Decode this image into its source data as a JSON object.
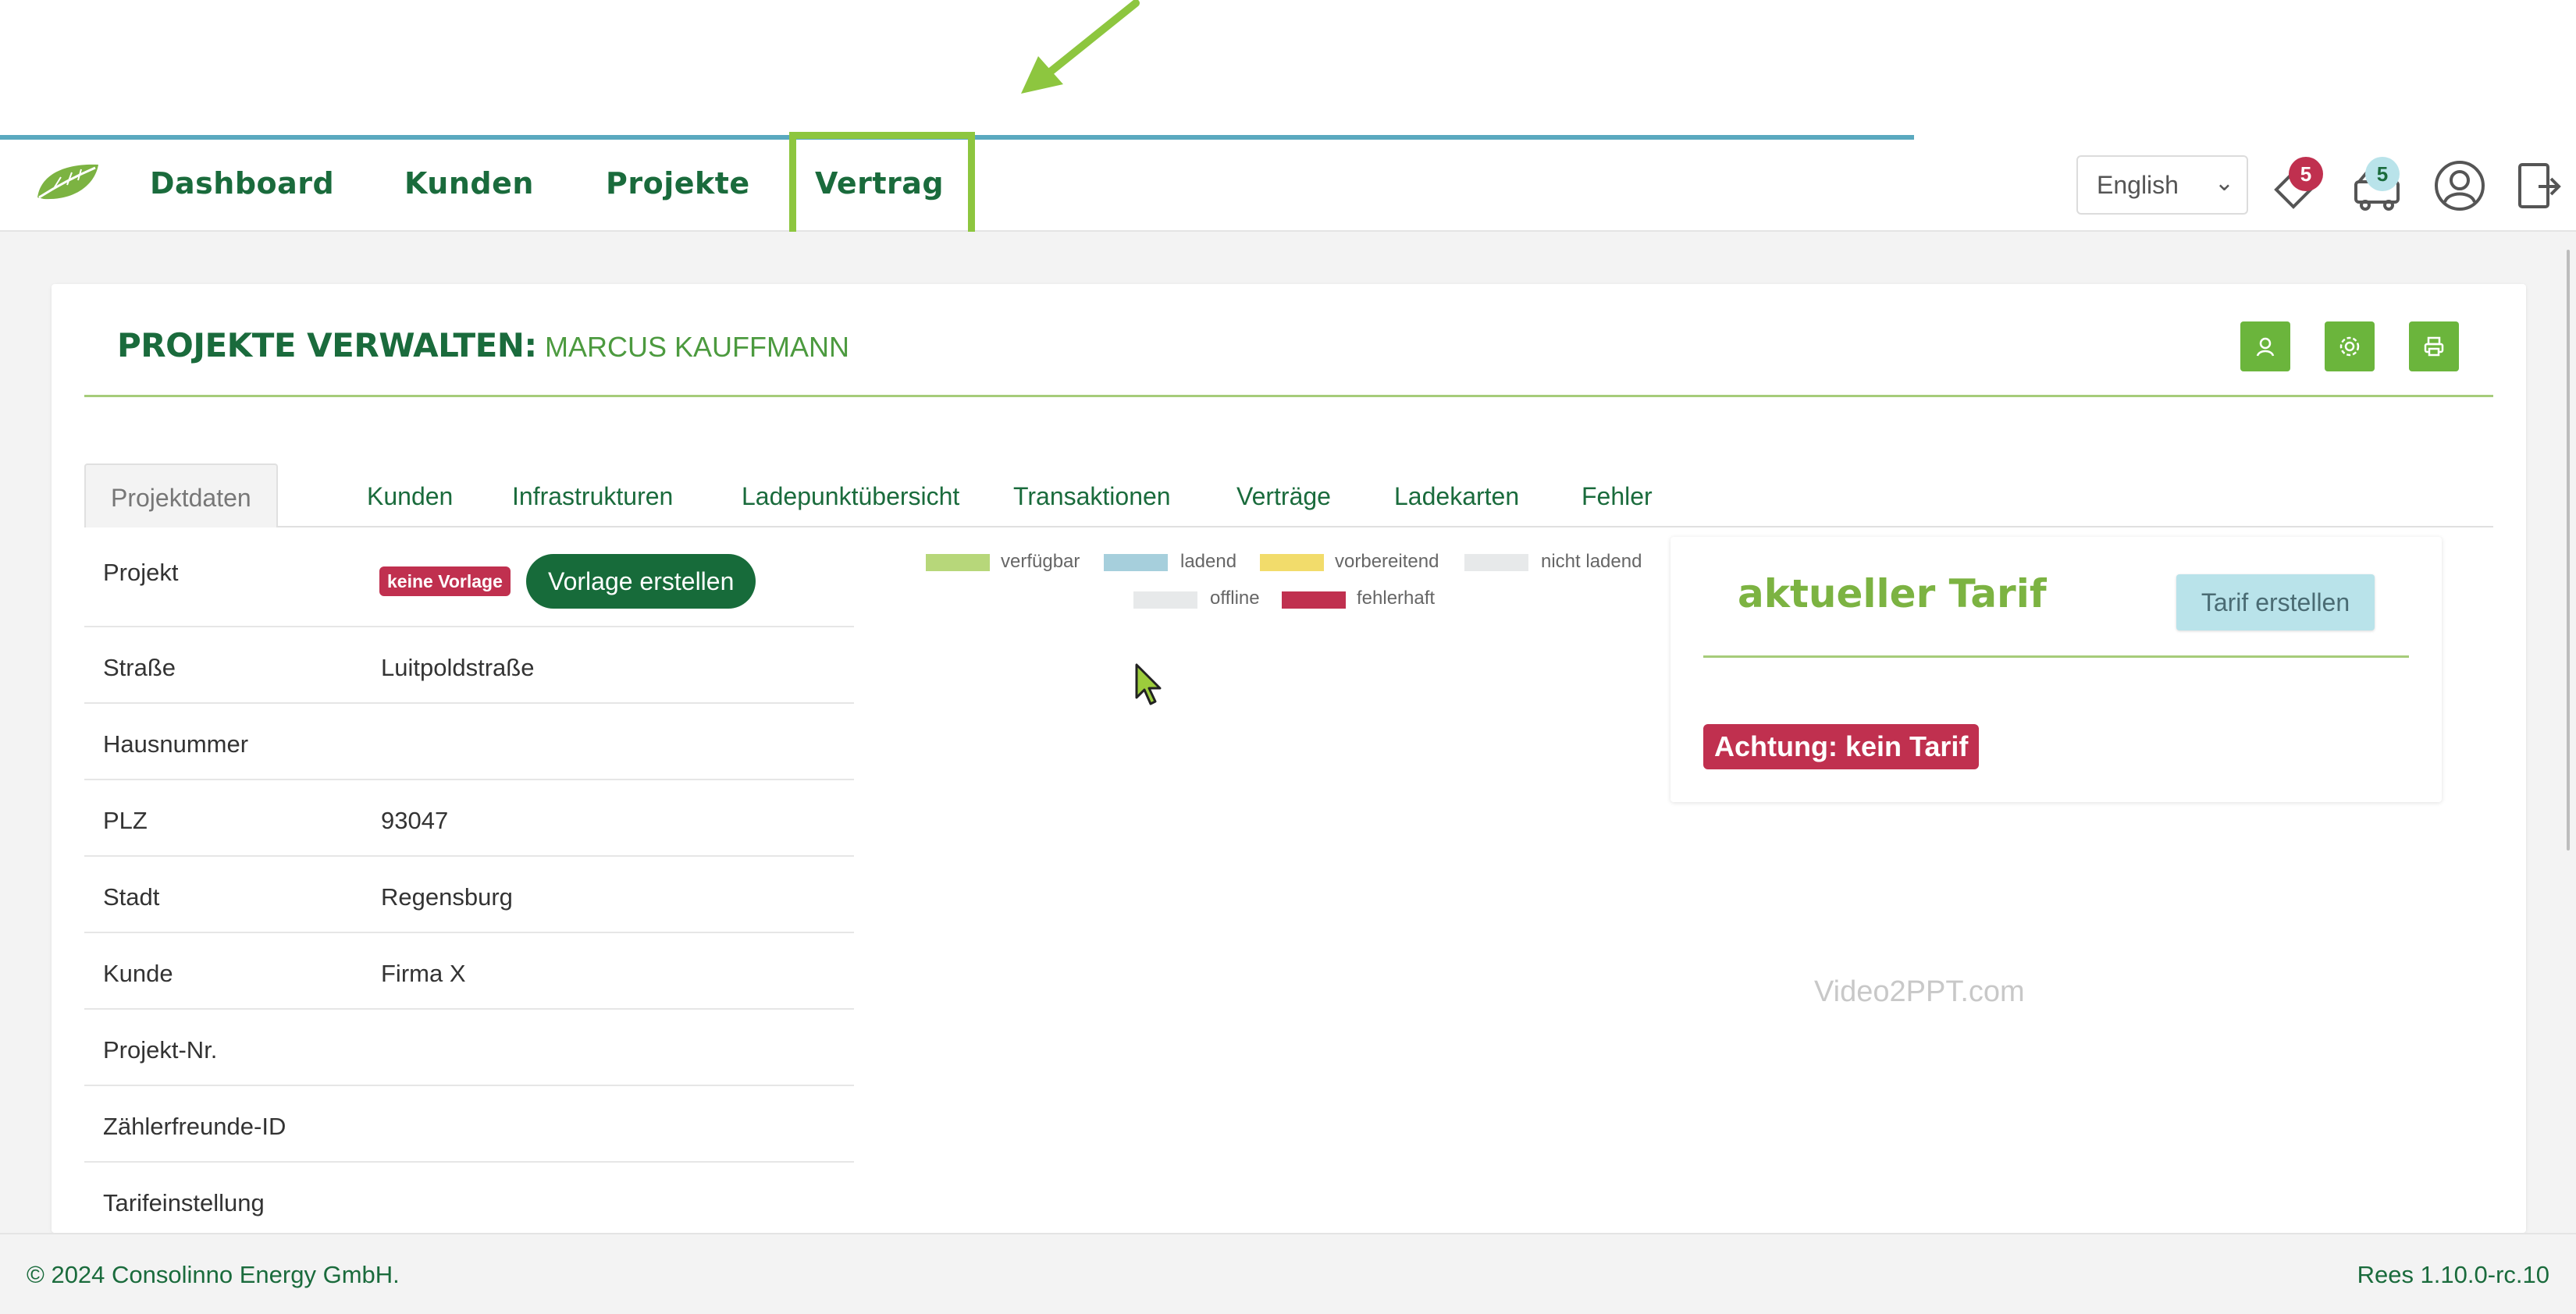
{
  "nav": {
    "items": [
      "Dashboard",
      "Kunden",
      "Projekte",
      "Vertrag"
    ],
    "language": "English",
    "notifications_count": "5",
    "charging_count": "5"
  },
  "header": {
    "title": "PROJEKTE VERWALTEN:",
    "subtitle": "MARCUS KAUFFMANN"
  },
  "tabs": [
    "Projektdaten",
    "Kunden",
    "Infrastrukturen",
    "Ladepunktübersicht",
    "Transaktionen",
    "Verträge",
    "Ladekarten",
    "Fehler"
  ],
  "project": {
    "rows": [
      {
        "label": "Projekt",
        "value": ""
      },
      {
        "label": "Straße",
        "value": "Luitpoldstraße"
      },
      {
        "label": "Hausnummer",
        "value": ""
      },
      {
        "label": "PLZ",
        "value": "93047"
      },
      {
        "label": "Stadt",
        "value": "Regensburg"
      },
      {
        "label": "Kunde",
        "value": "Firma X"
      },
      {
        "label": "Projekt-Nr.",
        "value": ""
      },
      {
        "label": "Zählerfreunde-ID",
        "value": ""
      },
      {
        "label": "Tarifeinstellung",
        "value": ""
      }
    ],
    "no_template_badge": "keine Vorlage",
    "create_template_button": "Vorlage erstellen"
  },
  "legend": [
    {
      "label": "verfügbar",
      "color": "#b7d77a"
    },
    {
      "label": "ladend",
      "color": "#a6cfdc"
    },
    {
      "label": "vorbereitend",
      "color": "#f2dc6b"
    },
    {
      "label": "nicht ladend",
      "color": "#e7e9ea"
    },
    {
      "label": "offline",
      "color": "#e7e9ea"
    },
    {
      "label": "fehlerhaft",
      "color": "#c0304f"
    }
  ],
  "tarif": {
    "title": "aktueller Tarif",
    "create_button": "Tarif erstellen",
    "alert": "Achtung: kein Tarif"
  },
  "watermark": "Video2PPT.com",
  "footer": {
    "copyright": "© 2024 Consolinno Energy GmbH.",
    "version": "Rees 1.10.0-rc.10"
  }
}
